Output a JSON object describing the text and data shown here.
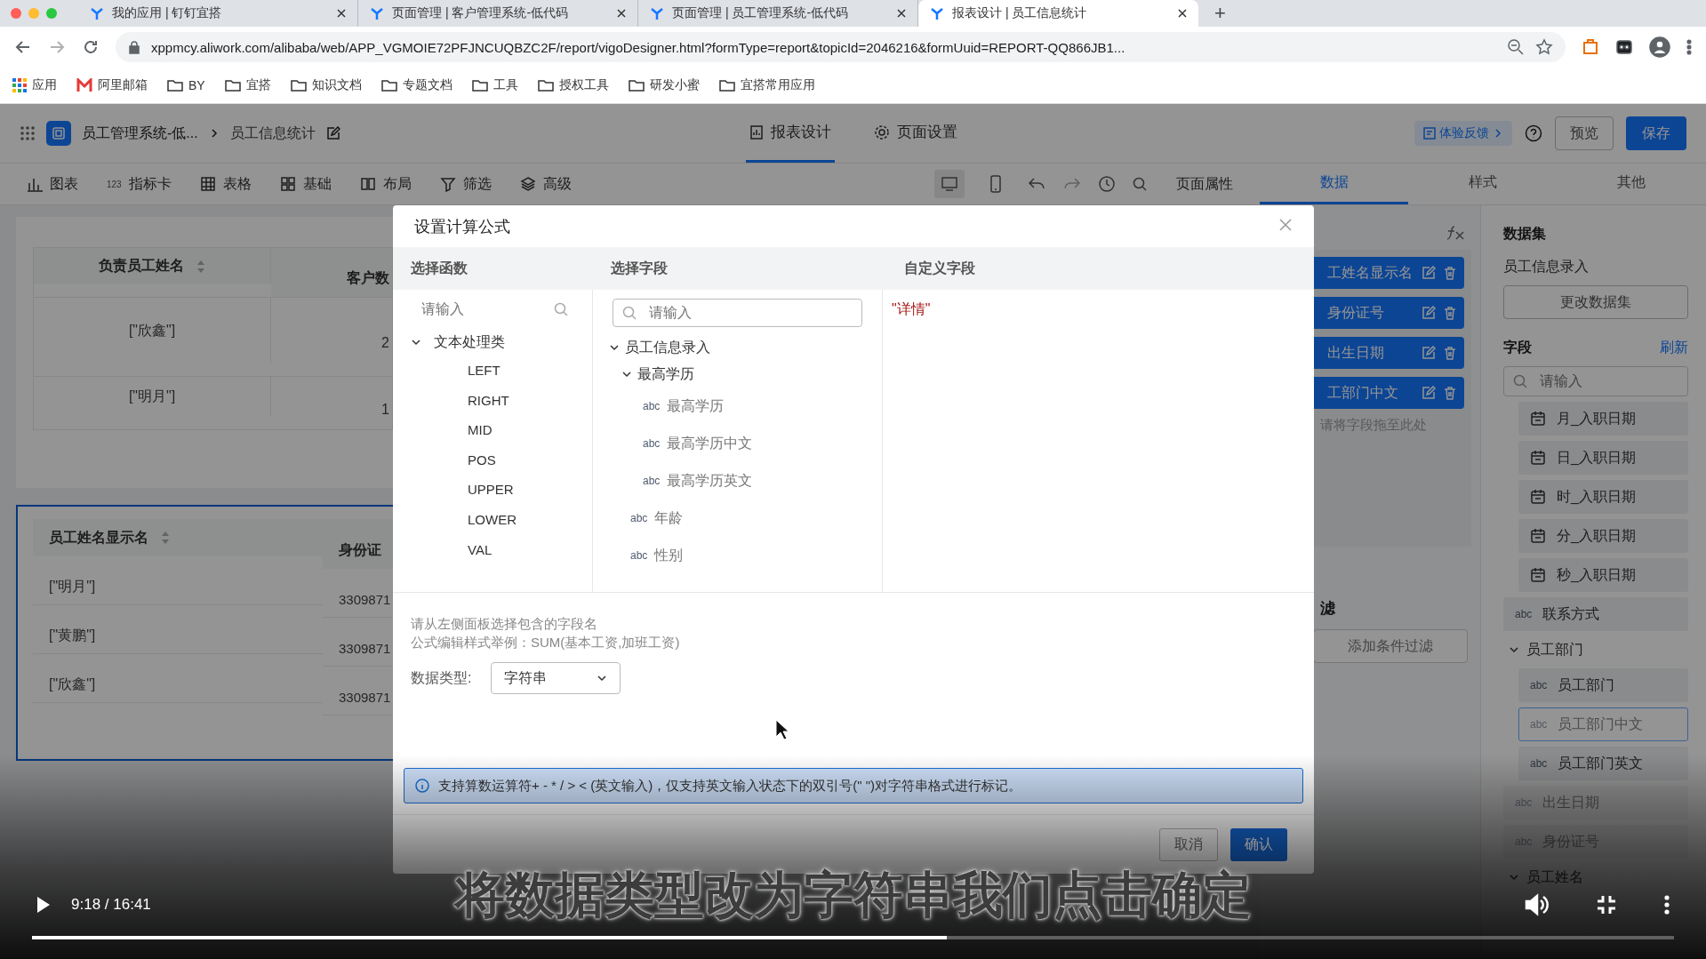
{
  "browser": {
    "tabs": [
      {
        "title": "我的应用 | 钉钉宜搭",
        "selected": false
      },
      {
        "title": "页面管理 | 客户管理系统-低代码",
        "selected": false
      },
      {
        "title": "页面管理 | 员工管理系统-低代码",
        "selected": false
      },
      {
        "title": "报表设计 | 员工信息统计",
        "selected": true
      }
    ],
    "new_tab": "+",
    "url": "xppmcy.aliwork.com/alibaba/web/APP_VGMOIE72PFJNCUQBZC2F/report/vigoDesigner.html?formType=report&topicId=2046216&formUuid=REPORT-QQ866JB1...",
    "bookmarks": [
      {
        "label": "应用",
        "kind": "apps"
      },
      {
        "label": "阿里邮箱",
        "kind": "mail"
      },
      {
        "label": "BY",
        "kind": "folder"
      },
      {
        "label": "宜搭",
        "kind": "folder"
      },
      {
        "label": "知识文档",
        "kind": "folder"
      },
      {
        "label": "专题文档",
        "kind": "folder"
      },
      {
        "label": "工具",
        "kind": "folder"
      },
      {
        "label": "授权工具",
        "kind": "folder"
      },
      {
        "label": "研发小蜜",
        "kind": "folder"
      },
      {
        "label": "宜搭常用应用",
        "kind": "folder"
      }
    ]
  },
  "header": {
    "app_name": "员工管理系统-低...",
    "page_name": "员工信息统计",
    "tabs": [
      {
        "label": "报表设计",
        "kind": "design",
        "selected": true
      },
      {
        "label": "页面设置",
        "kind": "settings",
        "selected": false
      }
    ],
    "feedback": "体验反馈",
    "preview": "预览",
    "save": "保存"
  },
  "toolbar": {
    "items": [
      {
        "label": "图表",
        "kind": "chart"
      },
      {
        "label": "指标卡",
        "kind": "metric",
        "badge": "123"
      },
      {
        "label": "表格",
        "kind": "table"
      },
      {
        "label": "基础",
        "kind": "basic"
      },
      {
        "label": "布局",
        "kind": "layout"
      },
      {
        "label": "筛选",
        "kind": "filter"
      },
      {
        "label": "高级",
        "kind": "advanced"
      }
    ],
    "devices": [
      {
        "kind": "desktop",
        "selected": true
      },
      {
        "kind": "mobile",
        "selected": false
      }
    ],
    "page_props": "页面属性"
  },
  "panel_tabs": [
    {
      "label": "数据",
      "selected": true
    },
    {
      "label": "样式",
      "selected": false
    },
    {
      "label": "其他",
      "selected": false
    }
  ],
  "canvas": {
    "tables": [
      {
        "kind": "summary",
        "selected": false,
        "columns": [
          {
            "label": "负责员工姓名",
            "sortable": true
          },
          {
            "label": "客户数",
            "sortable": false
          }
        ],
        "rows": [
          [
            "[\"欣鑫\"]",
            "2"
          ],
          [
            "[\"明月\"]",
            "1"
          ]
        ]
      },
      {
        "kind": "detail",
        "selected": true,
        "columns": [
          {
            "label": "员工姓名显示名",
            "sortable": true
          },
          {
            "label": "身份证",
            "sortable": false
          }
        ],
        "rows": [
          [
            "[\"明月\"]",
            "3309871"
          ],
          [
            "[\"黄鹏\"]",
            "3309871"
          ],
          [
            "[\"欣鑫\"]",
            "3309871"
          ]
        ]
      }
    ]
  },
  "config": {
    "fields": [
      "工姓名显示名",
      "身份证号",
      "出生日期",
      "工部门中文"
    ],
    "drop_hint": "请将字段拖至此处",
    "filter_title": "滤",
    "add_filter": "添加条件过滤"
  },
  "dataset": {
    "title": "数据集",
    "name": "员工信息录入",
    "change": "更改数据集",
    "fields_title": "字段",
    "refresh": "刷新",
    "search_placeholder": "请输入",
    "fields": [
      {
        "kind": "group",
        "children": [
          {
            "kind": "date",
            "label": "月_入职日期",
            "disabled": false,
            "selected": false
          },
          {
            "kind": "date",
            "label": "日_入职日期",
            "disabled": false,
            "selected": false
          },
          {
            "kind": "date",
            "label": "时_入职日期",
            "disabled": false,
            "selected": false
          },
          {
            "kind": "date",
            "label": "分_入职日期",
            "disabled": false,
            "selected": false
          },
          {
            "kind": "date",
            "label": "秒_入职日期",
            "disabled": false,
            "selected": false
          }
        ]
      },
      {
        "kind": "text",
        "tag": "abc",
        "label": "联系方式",
        "disabled": false,
        "selected": false
      },
      {
        "kind": "group",
        "label": "员工部门",
        "expanded": true,
        "children": [
          {
            "kind": "text",
            "tag": "abc",
            "label": "员工部门",
            "disabled": false,
            "selected": false
          },
          {
            "kind": "text",
            "tag": "abc",
            "label": "员工部门中文",
            "disabled": true,
            "selected": true
          },
          {
            "kind": "text",
            "tag": "abc",
            "label": "员工部门英文",
            "disabled": false,
            "selected": false
          }
        ]
      },
      {
        "kind": "text",
        "tag": "abc",
        "label": "出生日期",
        "disabled": true,
        "selected": false
      },
      {
        "kind": "text",
        "tag": "abc",
        "label": "身份证号",
        "disabled": true,
        "selected": false
      },
      {
        "kind": "group",
        "label": "员工姓名",
        "expanded": true
      }
    ]
  },
  "dialog": {
    "title": "设置计算公式",
    "columns": [
      "选择函数",
      "选择字段",
      "自定义字段"
    ],
    "functions": {
      "placeholder": "请输入",
      "groups": [
        {
          "label": "文本处理类",
          "expanded": true,
          "children": [
            "LEFT",
            "RIGHT",
            "MID",
            "POS",
            "UPPER",
            "LOWER",
            "VAL"
          ]
        }
      ]
    },
    "fields": {
      "placeholder": "请输入",
      "tree": [
        {
          "kind": "group",
          "label": "员工信息录入",
          "expanded": true,
          "children": [
            {
              "kind": "group",
              "label": "最高学历",
              "expanded": true,
              "children": [
                {
                  "kind": "text",
                  "tag": "abc",
                  "label": "最高学历"
                },
                {
                  "kind": "text",
                  "tag": "abc",
                  "label": "最高学历中文"
                },
                {
                  "kind": "text",
                  "tag": "abc",
                  "label": "最高学历英文"
                }
              ]
            },
            {
              "kind": "text",
              "tag": "abc",
              "label": "年龄"
            },
            {
              "kind": "text",
              "tag": "abc",
              "label": "性别"
            }
          ]
        }
      ]
    },
    "formula": "\"详情\"",
    "hints": [
      "请从左侧面板选择包含的字段名",
      "公式编辑样式举例：SUM(基本工资,加班工资)"
    ],
    "type_label": "数据类型:",
    "type_value": "字符串",
    "info": "支持算数运算符+ - * / > < (英文输入)，仅支持英文输入状态下的双引号(\" \")对字符串格式进行标记。",
    "cancel": "取消",
    "confirm": "确认"
  },
  "video": {
    "time": "9:18 / 16:41",
    "level": 0.557,
    "subtitle": "将数据类型改为字符串我们点击确定"
  }
}
